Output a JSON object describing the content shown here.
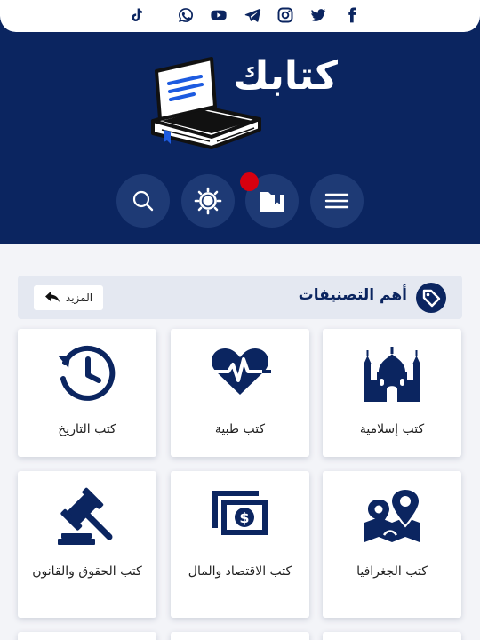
{
  "social": {
    "icons": [
      "tiktok-icon",
      "whatsapp-icon",
      "youtube-icon",
      "telegram-icon",
      "instagram-icon",
      "twitter-icon",
      "facebook-icon"
    ]
  },
  "brand": {
    "logo_text": "كتابك",
    "logo_icon": "open-book-icon"
  },
  "header_buttons": [
    "search-icon",
    "sun-icon",
    "folder-book-icon",
    "menu-icon"
  ],
  "colors": {
    "primary": "#0b2560",
    "button_bg": "#1e3a75",
    "notification": "#d7000f",
    "accent_blue": "#1d5be0",
    "page_bg": "#f3f4f8",
    "section_bar": "#e4e8f1"
  },
  "categories_section": {
    "title": "أهم التصنيفات",
    "more_label": "المزيد",
    "more_icon": "reply-arrow-icon",
    "title_icon": "tag-icon"
  },
  "categories": [
    {
      "label": "كتب إسلامية",
      "icon": "mosque-icon"
    },
    {
      "label": "كتب طبية",
      "icon": "heart-pulse-icon"
    },
    {
      "label": "كتب التاريخ",
      "icon": "history-clock-icon"
    },
    {
      "label": "كتب الجغرافيا",
      "icon": "map-location-icon"
    },
    {
      "label": "كتب الاقتصاد والمال",
      "icon": "money-bill-icon"
    },
    {
      "label": "كتب الحقوق والقانون",
      "icon": "gavel-icon"
    }
  ]
}
